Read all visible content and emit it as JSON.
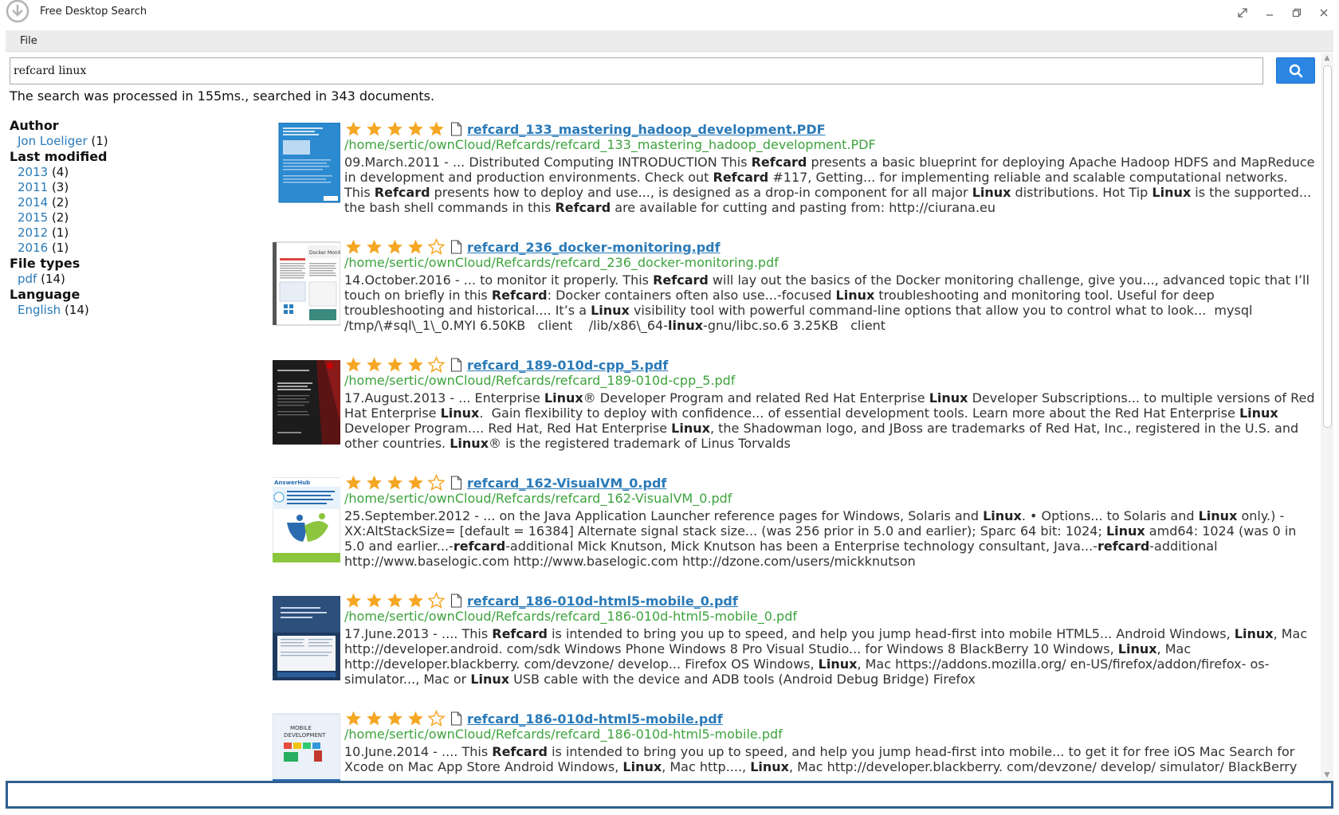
{
  "window": {
    "title": "Free Desktop Search"
  },
  "menu": {
    "file": "File"
  },
  "search": {
    "query": "refcard linux",
    "button_icon": "search-icon"
  },
  "status": "The search was processed in 155ms., searched in 343 documents.",
  "facets": [
    {
      "title": "Author",
      "items": [
        {
          "label": "Jon Loeliger",
          "count": "(1)"
        }
      ]
    },
    {
      "title": "Last modified",
      "items": [
        {
          "label": "2013",
          "count": "(4)"
        },
        {
          "label": "2011",
          "count": "(3)"
        },
        {
          "label": "2014",
          "count": "(2)"
        },
        {
          "label": "2015",
          "count": "(2)"
        },
        {
          "label": "2012",
          "count": "(1)"
        },
        {
          "label": "2016",
          "count": "(1)"
        }
      ]
    },
    {
      "title": "File types",
      "items": [
        {
          "label": "pdf",
          "count": "(14)"
        }
      ]
    },
    {
      "title": "Language",
      "items": [
        {
          "label": "English",
          "count": "(14)"
        }
      ]
    }
  ],
  "results": [
    {
      "rating": 5,
      "title": "refcard_133_mastering_hadoop_development.PDF",
      "path": "/home/sertic/ownCloud/Refcards/refcard_133_mastering_hadoop_development.PDF",
      "snippet": "09.March.2011 - ... Distributed Computing INTRODUCTION This **Refcard** presents a basic blueprint for deploying Apache Hadoop HDFS and MapReduce in development and production environments. Check out **Refcard** #117, Getting... for implementing reliable and scalable computational networks. This **Refcard** presents how to deploy and use..., is designed as a drop-in component for all major **Linux** distributions. Hot Tip **Linux** is the supported... the bash shell commands in this **Refcard** are available for cutting and pasting from: http://ciurana.eu",
      "thumb": "hadoop"
    },
    {
      "rating": 4,
      "title": "refcard_236_docker-monitoring.pdf",
      "path": "/home/sertic/ownCloud/Refcards/refcard_236_docker-monitoring.pdf",
      "snippet": "14.October.2016 - ... to monitor it properly. This **Refcard** will lay out the basics of the Docker monitoring challenge, give you..., advanced topic that I’ll touch on briefly in this **Refcard**: Docker containers often also use...-focused **Linux** troubleshooting and monitoring tool. Useful for deep troubleshooting and historical.... It’s a **Linux** visibility tool with powerful command-line options that allow you to control what to look...  mysql /tmp/\\#sql\\_1\\_0.MYI 6.50KB   client    /lib/x86\\_64-**linux**-gnu/libc.so.6 3.25KB   client",
      "thumb": "docker"
    },
    {
      "rating": 4,
      "title": "refcard_189-010d-cpp_5.pdf",
      "path": "/home/sertic/ownCloud/Refcards/refcard_189-010d-cpp_5.pdf",
      "snippet": "17.August.2013 - ... Enterprise **Linux**® Developer Program and related Red Hat Enterprise **Linux** Developer Subscriptions... to multiple versions of Red Hat Enterprise **Linux**.  Gain flexibility to deploy with confidence... of essential development tools. Learn more about the Red Hat Enterprise **Linux** Developer Program.... Red Hat, Red Hat Enterprise **Linux**, the Shadowman logo, and JBoss are trademarks of Red Hat, Inc., registered in the U.S. and other countries. **Linux**® is the registered trademark of Linus Torvalds",
      "thumb": "redhat"
    },
    {
      "rating": 4,
      "title": "refcard_162-VisualVM_0.pdf",
      "path": "/home/sertic/ownCloud/Refcards/refcard_162-VisualVM_0.pdf",
      "snippet": "25.September.2012 - ... on the Java Application Launcher reference pages for Windows, Solaris and **Linux**. • Options... to Solaris and **Linux** only.) -XX:AltStackSize= [default = 16384] Alternate signal stack size... (was 256 prior in 5.0 and earlier); Sparc 64 bit: 1024; **Linux** amd64: 1024 (was 0 in 5.0 and earlier...-**refcard**-additional Mick Knutson, Mick Knutson has been a Enterprise technology consultant, Java...-**refcard**-additional http://www.baselogic.com http://www.baselogic.com http://dzone.com/users/mickknutson",
      "thumb": "visualvm"
    },
    {
      "rating": 4,
      "title": "refcard_186-010d-html5-mobile_0.pdf",
      "path": "/home/sertic/ownCloud/Refcards/refcard_186-010d-html5-mobile_0.pdf",
      "snippet": "17.June.2013 - .... This **Refcard** is intended to bring you up to speed, and help you jump head-first into mobile HTML5... Android Windows, **Linux**, Mac http://developer.android. com/sdk Windows Phone Windows 8 Pro Visual Studio... for Windows 8 BlackBerry 10 Windows, **Linux**, Mac http://developer.blackberry. com/devzone/ develop... Firefox OS Windows, **Linux**, Mac https://addons.mozilla.org/ en-US/firefox/addon/firefox- os-simulator..., Mac or **Linux** USB cable with the device and ADB tools (Android Debug Bridge) Firefox",
      "thumb": "html5a"
    },
    {
      "rating": 4,
      "title": "refcard_186-010d-html5-mobile.pdf",
      "path": "/home/sertic/ownCloud/Refcards/refcard_186-010d-html5-mobile.pdf",
      "snippet": "10.June.2014 - .... This **Refcard** is intended to bring you up to speed, and help you jump head-first into mobile... to get it for free iOS Mac Search for Xcode on Mac App Store Android Windows, **Linux**, Mac http...., **Linux**, Mac http://developer.blackberry. com/devzone/ develop/ simulator/ BlackBerry",
      "thumb": "html5b"
    }
  ],
  "colors": {
    "accent": "#2c86e3",
    "link": "#2a7ab8",
    "path": "#3da33d",
    "star": "#f5a623",
    "bottom_border": "#2f5f8f"
  }
}
